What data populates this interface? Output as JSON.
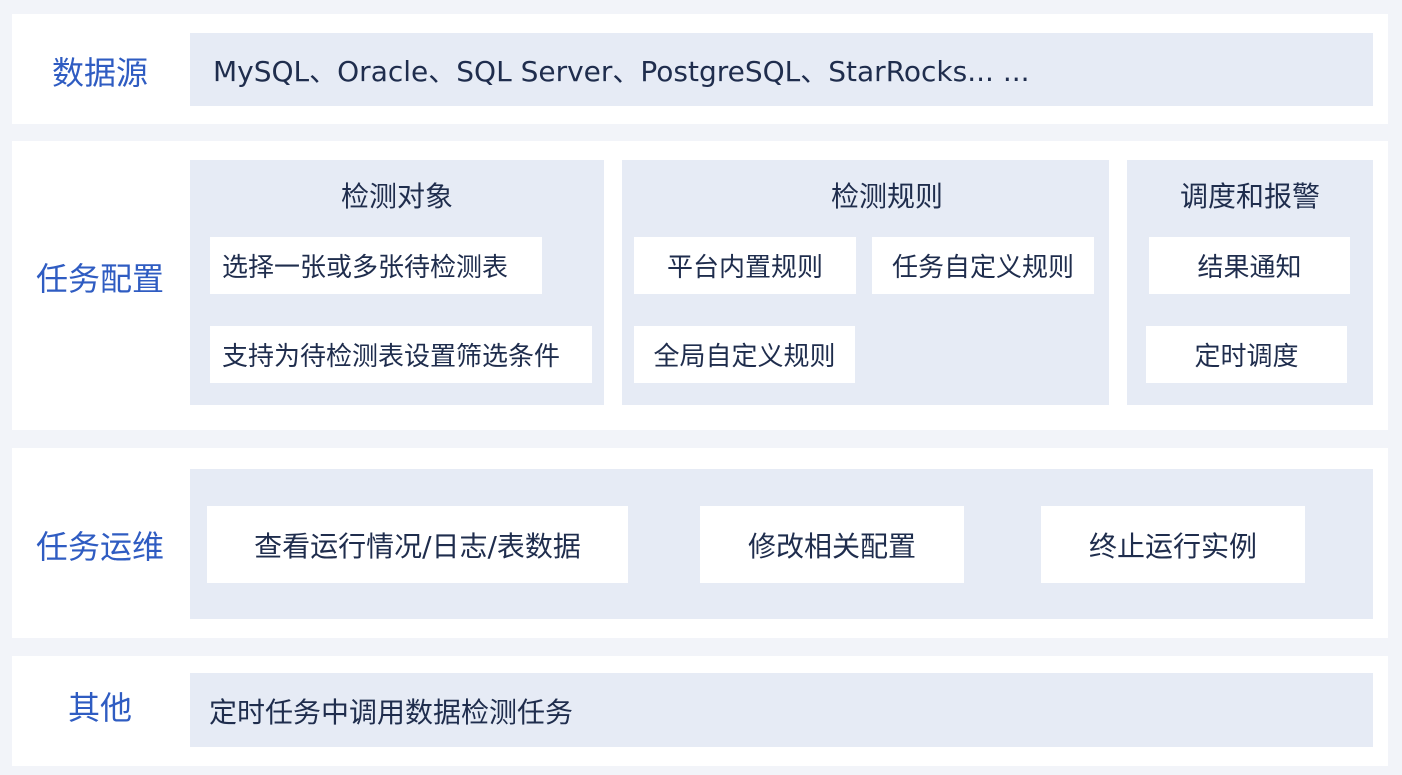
{
  "datasource": {
    "label": "数据源",
    "text": "MySQL、Oracle、SQL Server、PostgreSQL、StarRocks... ..."
  },
  "task_config": {
    "label": "任务配置",
    "groups": [
      {
        "title": "检测对象",
        "items": [
          "选择一张或多张待检测表",
          "支持为待检测表设置筛选条件"
        ]
      },
      {
        "title": "检测规则",
        "items": [
          "平台内置规则",
          "任务自定义规则",
          "全局自定义规则"
        ]
      },
      {
        "title": "调度和报警",
        "items": [
          "结果通知",
          "定时调度"
        ]
      }
    ]
  },
  "task_ops": {
    "label": "任务运维",
    "items": [
      "查看运行情况/日志/表数据",
      "修改相关配置",
      "终止运行实例"
    ]
  },
  "others": {
    "label": "其他",
    "text": "定时任务中调用数据检测任务"
  },
  "colors": {
    "label": "#2f5cc2",
    "panel": "#e6ebf5",
    "text": "#1f2d4d",
    "background": "#f2f4f9"
  }
}
